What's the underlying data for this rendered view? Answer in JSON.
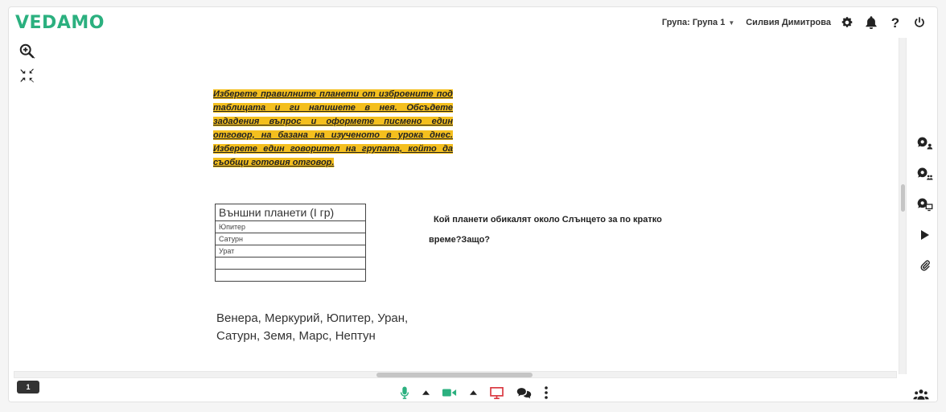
{
  "header": {
    "logo": "VEDAMO",
    "group_label": "Група: Група 1",
    "user_name": "Силвия Димитрова",
    "help_label": "?"
  },
  "board": {
    "task_text": "Изберете правилните планети от изброените под таблицата и ги напишете в нея. Обсъдете зададения въпрос и оформете писмено един отговор, на базана на изученото в урока днес. Изберете един говорител на групата, който да съобщи готовия отговор.",
    "table": {
      "header": "Външни планети (I гр)",
      "rows": [
        "Юпитер",
        "Сатурн",
        "Урат",
        "",
        ""
      ]
    },
    "question_line1": "Кой планети обикалят около Слънцето за по кратко",
    "question_line2": "време?Защо?",
    "planets_line1": "Венера, Меркурий, Юпитер, Уран,",
    "planets_line2": "Сатурн, Земя, Марс, Нептун"
  },
  "bottom": {
    "page_number": "1"
  },
  "colors": {
    "brand": "#2bb07f",
    "highlight": "#f4bf1e",
    "screen_share": "#d9373f"
  }
}
